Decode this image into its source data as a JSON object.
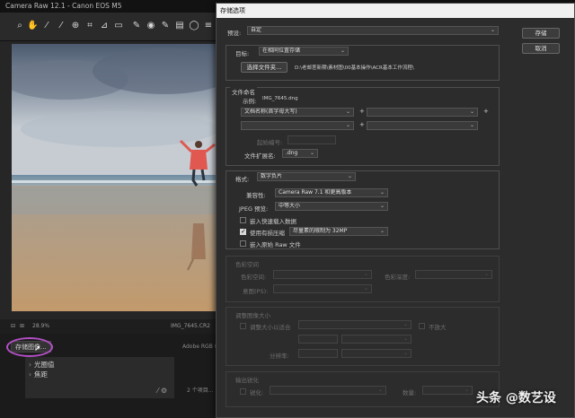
{
  "camera_raw": {
    "title": "Camera Raw 12.1  -  Canon EOS M5",
    "status_zoom": "28.9%",
    "status_filename": "IMG_7645.CR2",
    "save_image_button": "存储图像...",
    "workflow_link": "Adobe RGB (1",
    "panel": {
      "items": [
        "光圈值",
        "焦距"
      ]
    },
    "footer_info": "2 个项目..."
  },
  "dialog": {
    "title": "存储选项",
    "preset": {
      "label": "预设:",
      "value": "自定"
    },
    "save_button": "存储",
    "cancel_button": "取消",
    "destination": {
      "label": "目标:",
      "value": "在相同位置存储",
      "select_folder_button": "选择文件夹...",
      "path": "D:\\老邮差新期\\素材图\\00基本操作\\ACR基本工作流程\\"
    },
    "file_naming": {
      "section_title": "文件命名",
      "example_label": "示例:",
      "example_value": "IMG_7645.dng",
      "name_field_1": "文档名称(首字母大写)",
      "begin_number_label": "起始编号:",
      "extension_label": "文件扩展名:",
      "extension_value": ".dng"
    },
    "format": {
      "label": "格式:",
      "value": "数字负片",
      "compatibility_label": "兼容性:",
      "compatibility_value": "Camera Raw 7.1 和更高版本",
      "jpeg_preview_label": "JPEG 预览:",
      "jpeg_preview_value": "中等大小",
      "embed_fast_load": "嵌入快速载入数据",
      "lossy_compression": "使用有损压缩",
      "lossy_value": "尽量素的限制为 32MP",
      "embed_raw": "嵌入原始 Raw 文件"
    },
    "color_space": {
      "section_title": "色彩空间",
      "space_label": "色彩空间:",
      "depth_label": "色彩深度:",
      "intent_label": "意图(PS):"
    },
    "resize": {
      "section_title": "调整图像大小",
      "resize_to_fit": "调整大小以适合",
      "dont_enlarge": "不放大",
      "resolution_label": "分辨率:"
    },
    "sharpen": {
      "section_title": "输出锐化",
      "sharpen_for": "锐化:",
      "amount_label": "数量:"
    }
  },
  "watermark": "头条 @数艺设",
  "colors": {
    "highlight_oval": "#b34fc6",
    "dialog_bg": "#2c2c2c",
    "jacket": "#e0584f"
  }
}
